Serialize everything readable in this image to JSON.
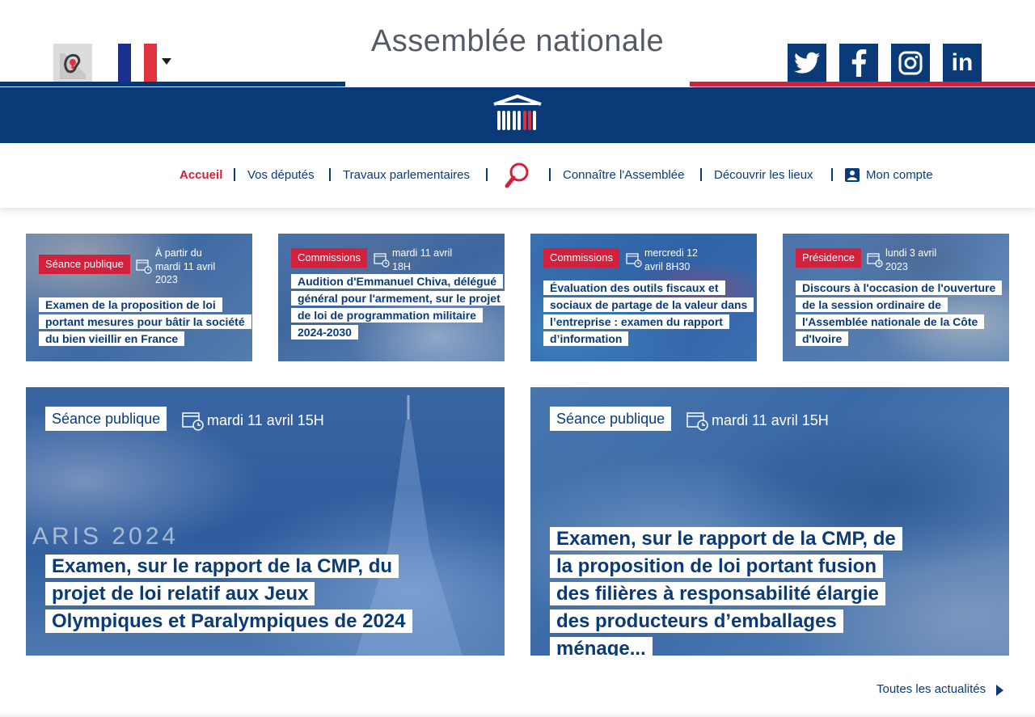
{
  "header": {
    "site_title": "Assemblée nationale",
    "accessibility_icon": "ear-accessibility-icon",
    "language_icon": "french-flag-icon",
    "social": [
      {
        "name": "twitter",
        "icon": "twitter-icon"
      },
      {
        "name": "facebook",
        "icon": "facebook-icon"
      },
      {
        "name": "instagram",
        "icon": "instagram-icon"
      },
      {
        "name": "linkedin",
        "icon": "linkedin-icon",
        "text": "in"
      }
    ],
    "logo_icon": "assemblee-hemicycle-logo-icon"
  },
  "nav": {
    "items": [
      {
        "label": "Accueil",
        "active": true
      },
      {
        "label": "Vos députés"
      },
      {
        "label": "Travaux parlementaires"
      },
      {
        "label": "Connaître l'Assemblée"
      },
      {
        "label": "Découvrir les lieux"
      },
      {
        "label": "Mon compte",
        "icon": "account-icon"
      }
    ],
    "search_icon": "search-icon"
  },
  "cards_small": [
    {
      "tag": "Séance publique",
      "date_lines": [
        "À partir du",
        "mardi 11 avril",
        "2023"
      ],
      "title": "Examen de la proposition de loi portant mesures pour bâtir la société du bien vieillir en France"
    },
    {
      "tag": "Commissions",
      "date_lines": [
        "mardi 11 avril",
        "18H"
      ],
      "title": "Audition d'Emmanuel Chiva, délégué général pour l'armement, sur le projet de loi de programmation militaire 2024-2030"
    },
    {
      "tag": "Commissions",
      "date_lines": [
        "mercredi 12",
        "avril 8H30"
      ],
      "title": "Évaluation des outils fiscaux et sociaux de partage de la valeur dans l’entreprise : examen du rapport d’information"
    },
    {
      "tag": "Présidence",
      "date_lines": [
        "lundi 3 avril",
        "2023"
      ],
      "title": "Discours à l'occasion de l'ouverture de la session ordinaire de l'Assemblée nationale de la Côte d'Ivoire"
    }
  ],
  "cards_big": [
    {
      "tag": "Séance publique",
      "date": "mardi 11 avril 15H",
      "title": "Examen, sur le rapport de la CMP, du projet de loi relatif aux Jeux Olympiques et Paralympiques de 2024",
      "image_text": "ARIS 2024"
    },
    {
      "tag": "Séance publique",
      "date": "mardi 11 avril 15H",
      "title": "Examen, sur le rapport de la CMP, de la proposition de loi portant fusion des filières à responsabilité élargie des producteurs d’emballages ménage..."
    }
  ],
  "footer": {
    "all_news_label": "Toutes les actualités",
    "arrow_icon": "chevron-right-icon"
  },
  "colors": {
    "navy": "#0a3b78",
    "red": "#d3203c",
    "grey_title": "#555b66"
  }
}
